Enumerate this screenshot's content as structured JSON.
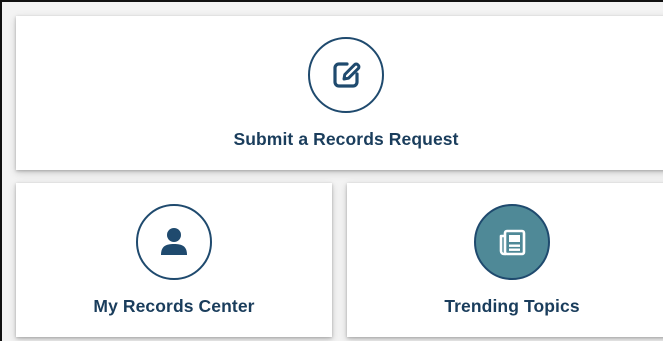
{
  "cards": {
    "submit": {
      "label": "Submit a Records Request",
      "icon": "edit-icon"
    },
    "my_records": {
      "label": "My Records Center",
      "icon": "user-icon"
    },
    "trending": {
      "label": "Trending Topics",
      "icon": "newspaper-icon"
    }
  },
  "colors": {
    "navy": "#1f4a6e",
    "label_text": "#1a3d5c",
    "teal_fill": "#4f8997",
    "card_bg": "#ffffff",
    "page_bg": "#f3f3f3"
  }
}
